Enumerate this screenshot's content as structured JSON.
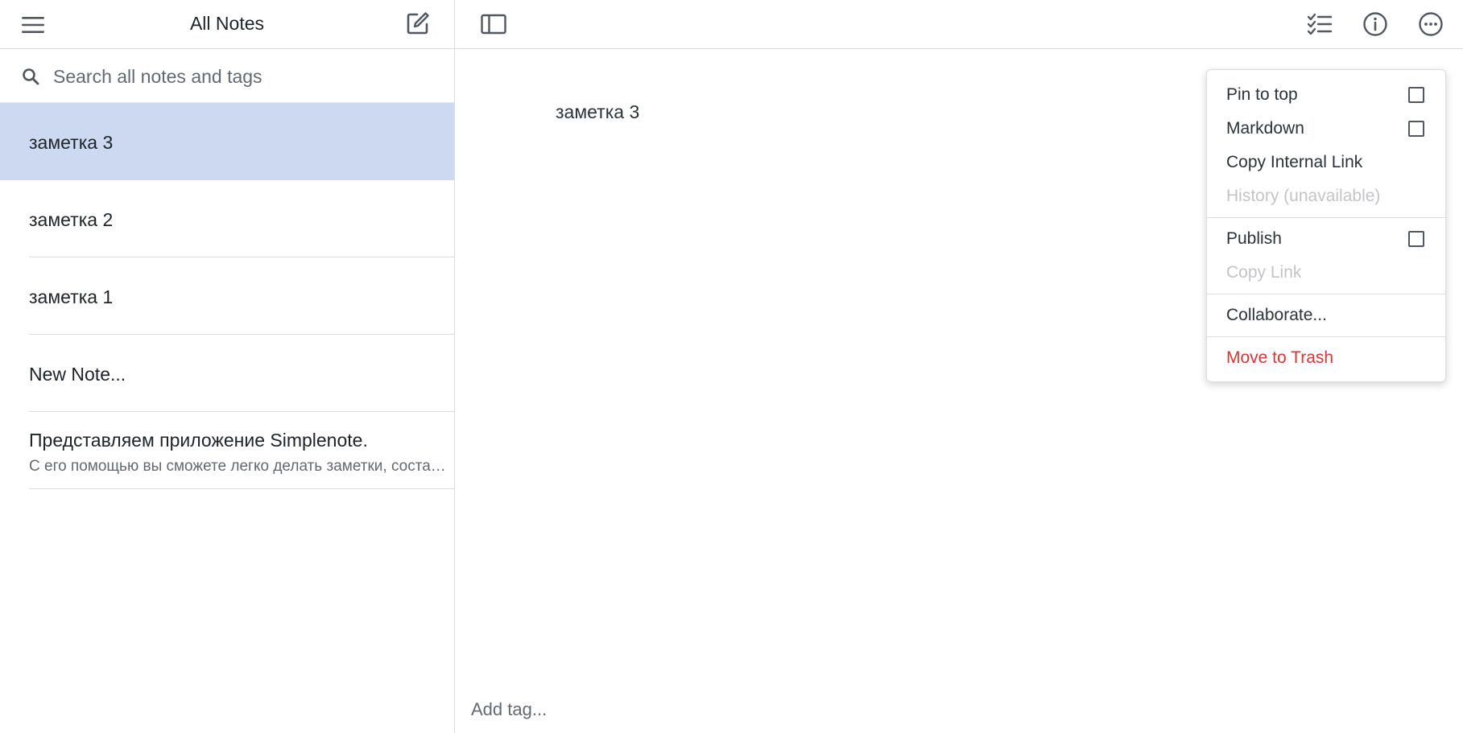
{
  "sidebar": {
    "title": "All Notes",
    "search_placeholder": "Search all notes and tags",
    "notes": [
      {
        "title": "заметка 3",
        "preview": "",
        "selected": true
      },
      {
        "title": "заметка 2",
        "preview": ""
      },
      {
        "title": "заметка 1",
        "preview": ""
      },
      {
        "title": "New Note...",
        "preview": ""
      },
      {
        "title": "Представляем приложение Simplenote.",
        "preview": "С его помощью вы сможете легко делать заметки, составлять списки, записывать идеи и многое другое."
      }
    ]
  },
  "editor": {
    "content": "заметка 3",
    "tag_placeholder": "Add tag..."
  },
  "menu": {
    "pin_to_top": "Pin to top",
    "markdown": "Markdown",
    "copy_internal_link": "Copy Internal Link",
    "history": "History (unavailable)",
    "publish": "Publish",
    "copy_link": "Copy Link",
    "collaborate": "Collaborate...",
    "move_to_trash": "Move to Trash"
  },
  "icons": {
    "menu": "hamburger-menu-icon",
    "new_note": "new-note-icon",
    "search": "search-icon",
    "sidebar_toggle": "sidebar-toggle-icon",
    "checklist": "checklist-icon",
    "info": "info-icon",
    "more": "more-icon"
  },
  "colors": {
    "selected_note": "#ccd9f0",
    "danger": "#d63638",
    "disabled": "#c3c4c7"
  }
}
